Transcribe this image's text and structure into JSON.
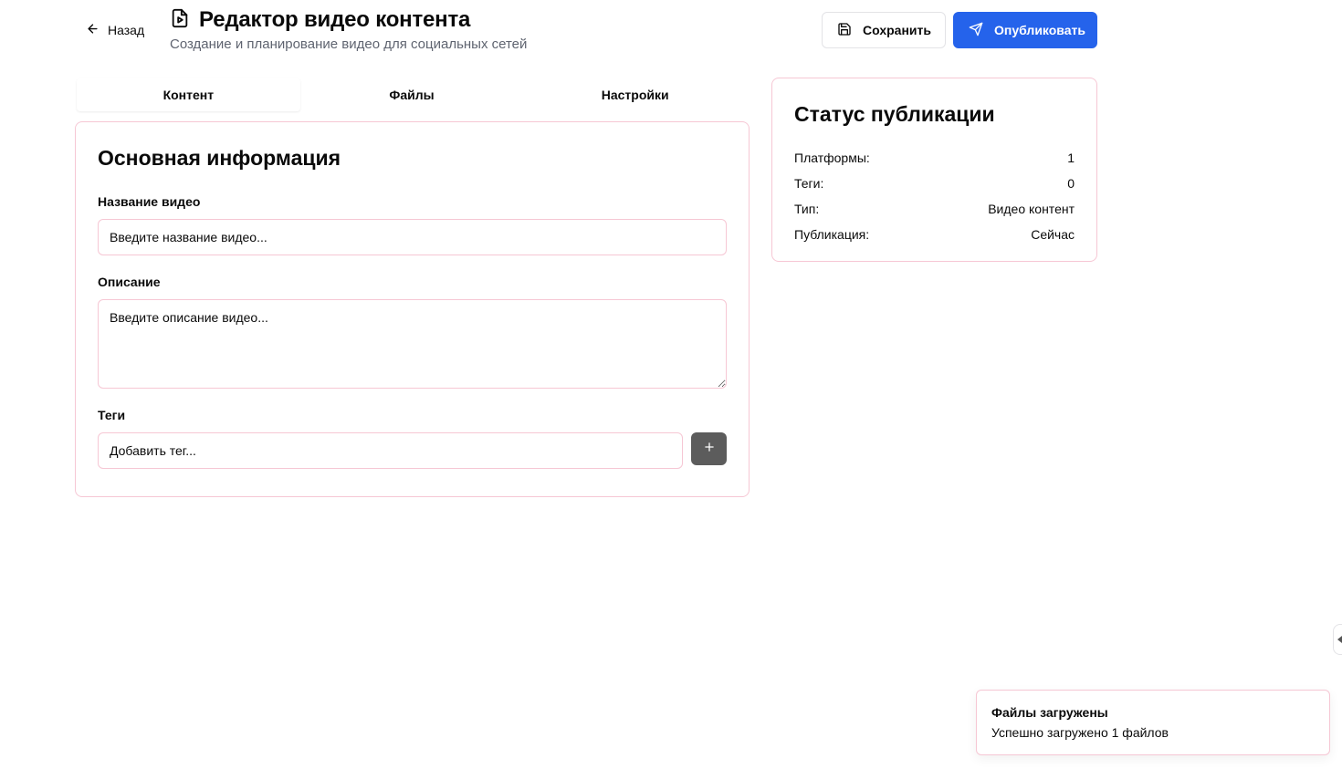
{
  "header": {
    "back_label": "Назад",
    "title": "Редактор видео контента",
    "subtitle": "Создание и планирование видео для социальных сетей",
    "save_label": "Сохранить",
    "publish_label": "Опубликовать",
    "icons": {
      "back": "arrow-left-icon",
      "title": "file-video-icon",
      "save": "save-icon",
      "publish": "send-icon"
    }
  },
  "tabs": [
    {
      "label": "Контент",
      "active": true
    },
    {
      "label": "Файлы",
      "active": false
    },
    {
      "label": "Настройки",
      "active": false
    }
  ],
  "content_card": {
    "title": "Основная информация",
    "name_label": "Название видео",
    "name_placeholder": "Введите название видео...",
    "description_label": "Описание",
    "description_placeholder": "Введите описание видео...",
    "tags_label": "Теги",
    "tag_placeholder": "Добавить тег...",
    "add_tag_icon": "plus-icon"
  },
  "status_card": {
    "title": "Статус публикации",
    "rows": [
      {
        "label": "Платформы:",
        "value": "1"
      },
      {
        "label": "Теги:",
        "value": "0"
      },
      {
        "label": "Тип:",
        "value": "Видео контент"
      },
      {
        "label": "Публикация:",
        "value": "Сейчас"
      }
    ]
  },
  "toast": {
    "title": "Файлы загружены",
    "description": "Успешно загружено 1 файлов"
  },
  "colors": {
    "primary": "#2563eb",
    "border_pink": "#f6c7d4",
    "muted_text": "#5f6470",
    "add_button": "#5c5c5c"
  }
}
